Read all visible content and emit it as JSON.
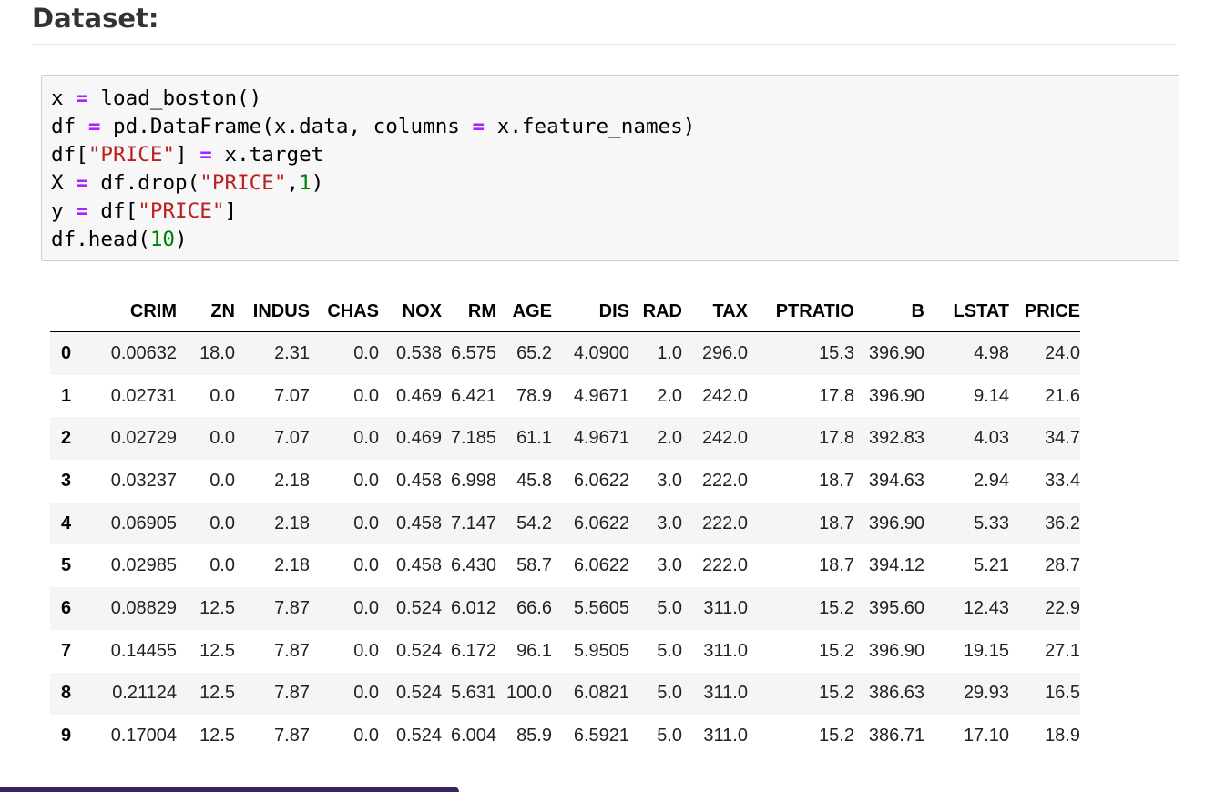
{
  "heading": "Dataset:",
  "code_lines": [
    [
      {
        "t": "x ",
        "c": "plain"
      },
      {
        "t": "=",
        "c": "op"
      },
      {
        "t": " load_boston()",
        "c": "plain"
      }
    ],
    [
      {
        "t": "df ",
        "c": "plain"
      },
      {
        "t": "=",
        "c": "op"
      },
      {
        "t": " pd.DataFrame(x.data, columns ",
        "c": "plain"
      },
      {
        "t": "=",
        "c": "op"
      },
      {
        "t": " x.feature_names)",
        "c": "plain"
      }
    ],
    [
      {
        "t": "df[",
        "c": "plain"
      },
      {
        "t": "\"PRICE\"",
        "c": "str"
      },
      {
        "t": "] ",
        "c": "plain"
      },
      {
        "t": "=",
        "c": "op"
      },
      {
        "t": " x.target",
        "c": "plain"
      }
    ],
    [
      {
        "t": "X ",
        "c": "plain"
      },
      {
        "t": "=",
        "c": "op"
      },
      {
        "t": " df.drop(",
        "c": "plain"
      },
      {
        "t": "\"PRICE\"",
        "c": "str"
      },
      {
        "t": ",",
        "c": "plain"
      },
      {
        "t": "1",
        "c": "num"
      },
      {
        "t": ")",
        "c": "plain"
      }
    ],
    [
      {
        "t": "y ",
        "c": "plain"
      },
      {
        "t": "=",
        "c": "op"
      },
      {
        "t": " df[",
        "c": "plain"
      },
      {
        "t": "\"PRICE\"",
        "c": "str"
      },
      {
        "t": "]",
        "c": "plain"
      }
    ],
    [
      {
        "t": "df.head(",
        "c": "plain"
      },
      {
        "t": "10",
        "c": "num"
      },
      {
        "t": ")",
        "c": "plain"
      }
    ]
  ],
  "table": {
    "columns": [
      "",
      "CRIM",
      "ZN",
      "INDUS",
      "CHAS",
      "NOX",
      "RM",
      "AGE",
      "DIS",
      "RAD",
      "TAX",
      "PTRATIO",
      "B",
      "LSTAT",
      "PRICE"
    ],
    "rows": [
      [
        "0",
        "0.00632",
        "18.0",
        "2.31",
        "0.0",
        "0.538",
        "6.575",
        "65.2",
        "4.0900",
        "1.0",
        "296.0",
        "15.3",
        "396.90",
        "4.98",
        "24.0"
      ],
      [
        "1",
        "0.02731",
        "0.0",
        "7.07",
        "0.0",
        "0.469",
        "6.421",
        "78.9",
        "4.9671",
        "2.0",
        "242.0",
        "17.8",
        "396.90",
        "9.14",
        "21.6"
      ],
      [
        "2",
        "0.02729",
        "0.0",
        "7.07",
        "0.0",
        "0.469",
        "7.185",
        "61.1",
        "4.9671",
        "2.0",
        "242.0",
        "17.8",
        "392.83",
        "4.03",
        "34.7"
      ],
      [
        "3",
        "0.03237",
        "0.0",
        "2.18",
        "0.0",
        "0.458",
        "6.998",
        "45.8",
        "6.0622",
        "3.0",
        "222.0",
        "18.7",
        "394.63",
        "2.94",
        "33.4"
      ],
      [
        "4",
        "0.06905",
        "0.0",
        "2.18",
        "0.0",
        "0.458",
        "7.147",
        "54.2",
        "6.0622",
        "3.0",
        "222.0",
        "18.7",
        "396.90",
        "5.33",
        "36.2"
      ],
      [
        "5",
        "0.02985",
        "0.0",
        "2.18",
        "0.0",
        "0.458",
        "6.430",
        "58.7",
        "6.0622",
        "3.0",
        "222.0",
        "18.7",
        "394.12",
        "5.21",
        "28.7"
      ],
      [
        "6",
        "0.08829",
        "12.5",
        "7.87",
        "0.0",
        "0.524",
        "6.012",
        "66.6",
        "5.5605",
        "5.0",
        "311.0",
        "15.2",
        "395.60",
        "12.43",
        "22.9"
      ],
      [
        "7",
        "0.14455",
        "12.5",
        "7.87",
        "0.0",
        "0.524",
        "6.172",
        "96.1",
        "5.9505",
        "5.0",
        "311.0",
        "15.2",
        "396.90",
        "19.15",
        "27.1"
      ],
      [
        "8",
        "0.21124",
        "12.5",
        "7.87",
        "0.0",
        "0.524",
        "5.631",
        "100.0",
        "6.0821",
        "5.0",
        "311.0",
        "15.2",
        "386.63",
        "29.93",
        "16.5"
      ],
      [
        "9",
        "0.17004",
        "12.5",
        "7.87",
        "0.0",
        "0.524",
        "6.004",
        "85.9",
        "6.5921",
        "5.0",
        "311.0",
        "15.2",
        "386.71",
        "17.10",
        "18.9"
      ]
    ]
  },
  "colors": {
    "operator": "#aa22ff",
    "string": "#ba2121",
    "number": "#008000",
    "code_bg": "#f7f7f7",
    "bottom_bar": "#3d2461"
  }
}
